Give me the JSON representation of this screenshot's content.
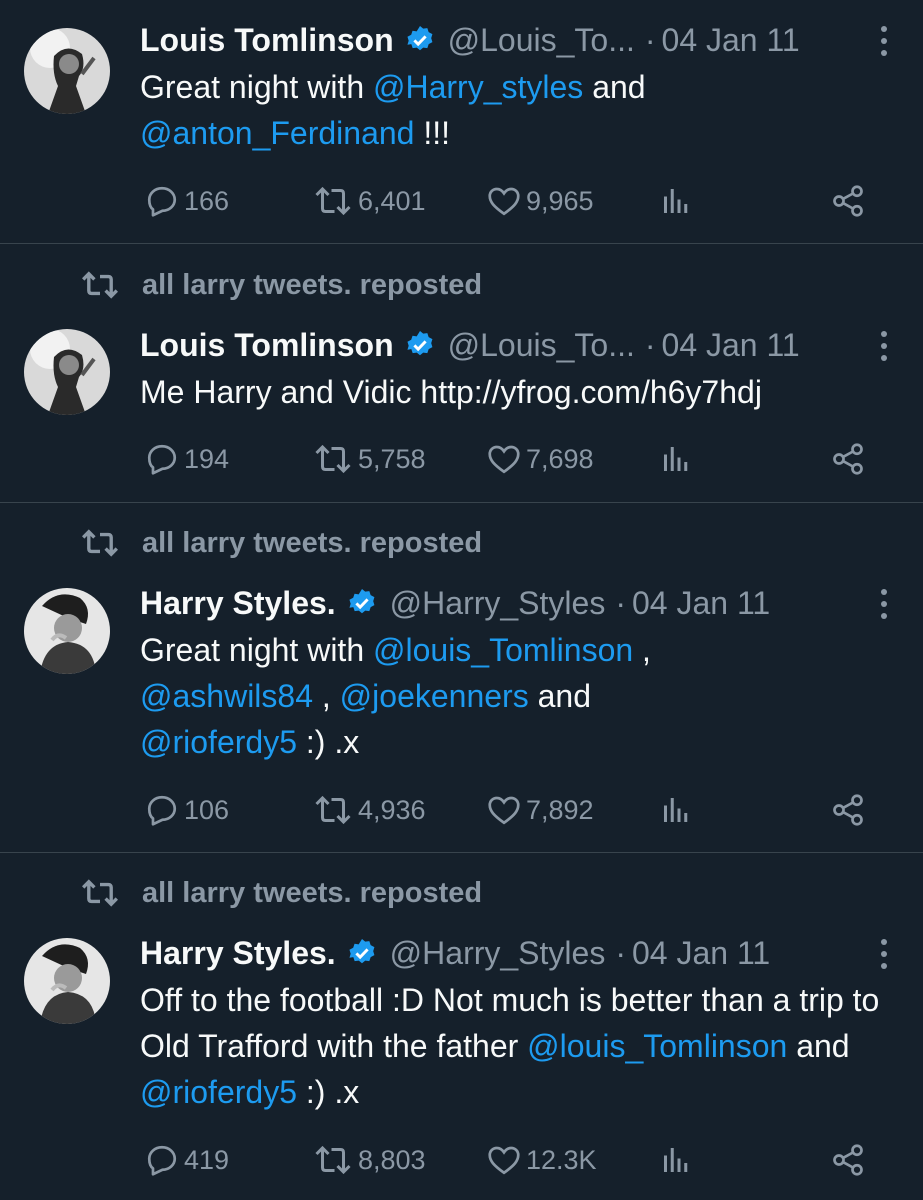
{
  "tweets": [
    {
      "reposted_by": "",
      "name": "Louis Tomlinson",
      "handle": "@Louis_To...",
      "date": "04 Jan 11",
      "text_parts": [
        {
          "t": "Great night with ",
          "m": false
        },
        {
          "t": "@Harry_styles",
          "m": true
        },
        {
          "t": " and ",
          "m": false
        },
        {
          "t": "@anton_Ferdinand",
          "m": true
        },
        {
          "t": " !!!",
          "m": false
        }
      ],
      "replies": "166",
      "reposts": "6,401",
      "likes": "9,965"
    },
    {
      "reposted_by": "all larry tweets. reposted",
      "name": "Louis Tomlinson",
      "handle": "@Louis_To...",
      "date": "04 Jan 11",
      "text_parts": [
        {
          "t": "Me Harry and Vidic http://yfrog.com/h6y7hdj",
          "m": false
        }
      ],
      "replies": "194",
      "reposts": "5,758",
      "likes": "7,698"
    },
    {
      "reposted_by": "all larry tweets. reposted",
      "name": "Harry Styles.",
      "handle": "@Harry_Styles",
      "date": "04 Jan 11",
      "text_parts": [
        {
          "t": "Great night with ",
          "m": false
        },
        {
          "t": "@louis_Tomlinson",
          "m": true
        },
        {
          "t": " , ",
          "m": false
        },
        {
          "t": "@ashwils84",
          "m": true
        },
        {
          "t": " , ",
          "m": false
        },
        {
          "t": "@joekenners",
          "m": true
        },
        {
          "t": " and ",
          "m": false
        },
        {
          "t": "@rioferdy5",
          "m": true
        },
        {
          "t": " :) .x",
          "m": false
        }
      ],
      "replies": "106",
      "reposts": "4,936",
      "likes": "7,892"
    },
    {
      "reposted_by": "all larry tweets. reposted",
      "name": "Harry Styles.",
      "handle": "@Harry_Styles",
      "date": "04 Jan 11",
      "text_parts": [
        {
          "t": "Off to the football :D  Not much is better than a trip to Old Trafford with the father ",
          "m": false
        },
        {
          "t": "@louis_Tomlinson",
          "m": true
        },
        {
          "t": " and ",
          "m": false
        },
        {
          "t": "@rioferdy5",
          "m": true
        },
        {
          "t": " :) .x",
          "m": false
        }
      ],
      "replies": "419",
      "reposts": "8,803",
      "likes": "12.3K"
    }
  ],
  "icons": {
    "repost": "repost-icon",
    "reply": "reply-icon",
    "like": "heart-icon",
    "views": "views-icon",
    "share": "share-icon",
    "verified": "verified-badge-icon",
    "more": "more-icon"
  },
  "colors": {
    "background": "#15202b",
    "text": "#f7f9f9",
    "muted": "#8b98a5",
    "link": "#1d9bf0",
    "divider": "#38444d"
  }
}
